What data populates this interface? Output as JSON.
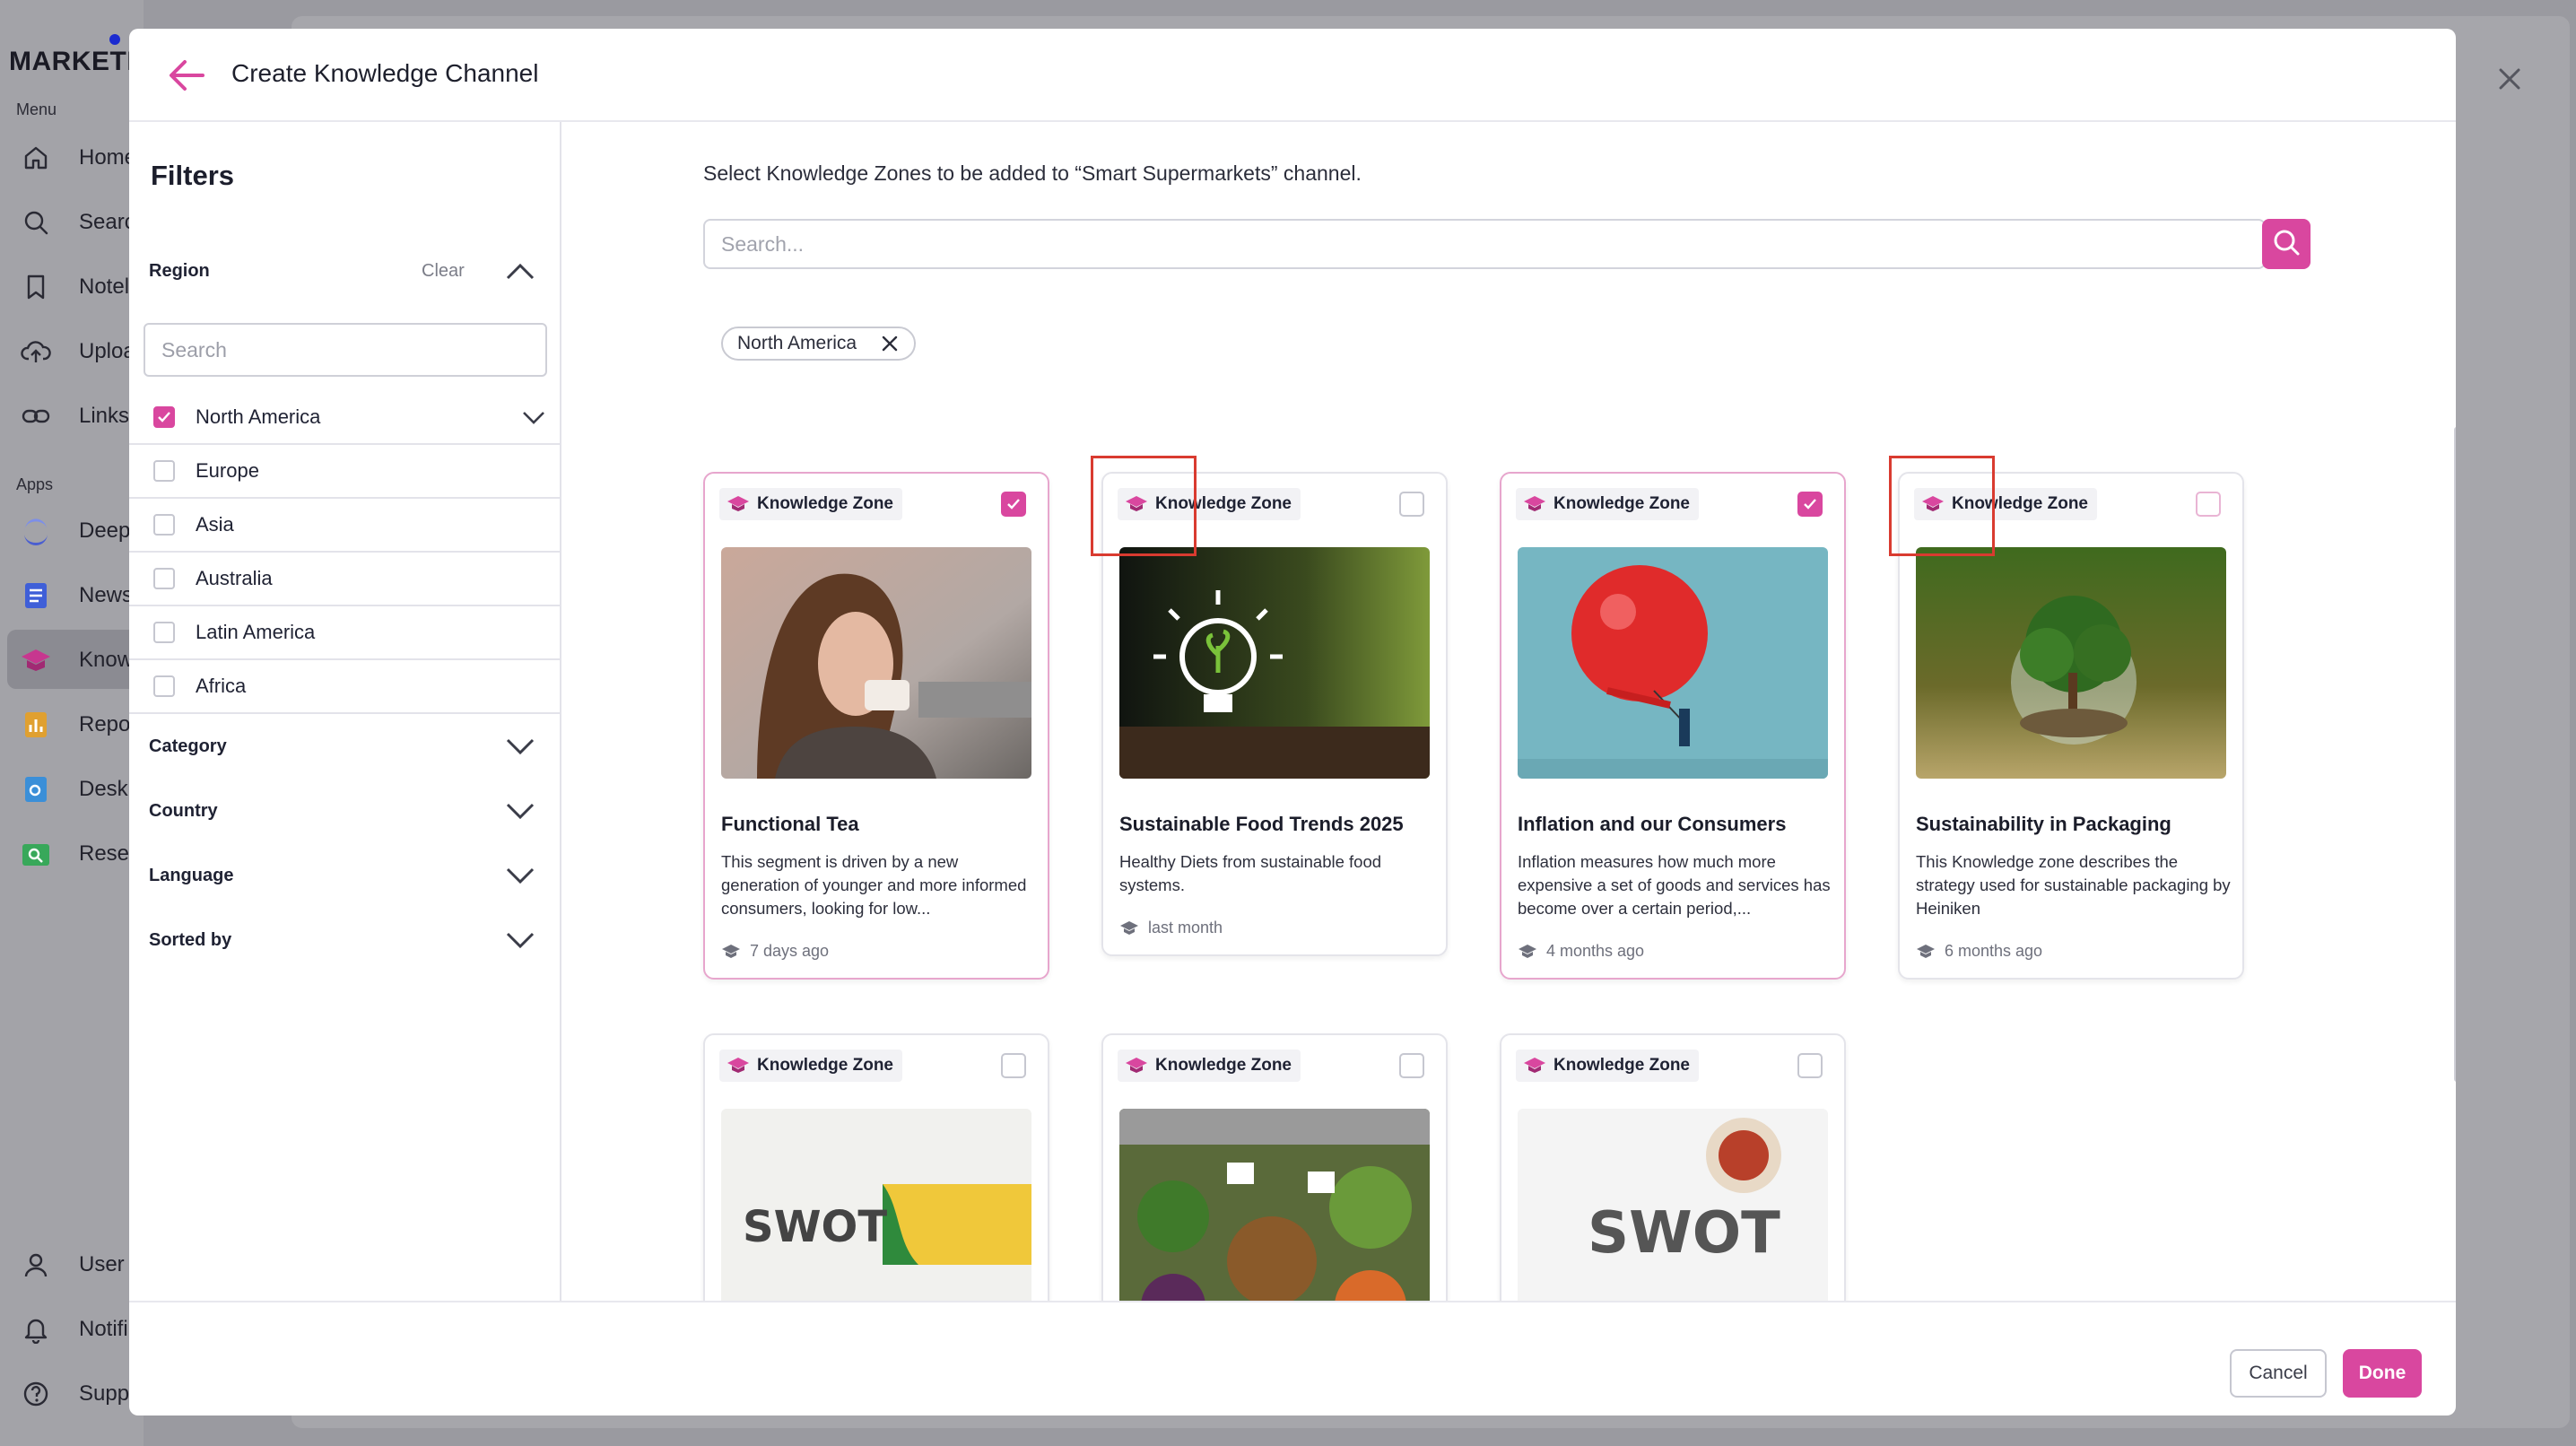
{
  "background": {
    "logo": "MARKETL",
    "menu_label": "Menu",
    "apps_label": "Apps",
    "menu_items": [
      {
        "label": "Home",
        "icon": "home-icon"
      },
      {
        "label": "Searc",
        "icon": "search-icon"
      },
      {
        "label": "Notel",
        "icon": "bookmark-icon"
      },
      {
        "label": "Uploa",
        "icon": "upload-cloud-icon"
      },
      {
        "label": "Links",
        "icon": "link-icon"
      }
    ],
    "app_items": [
      {
        "label": "Deep",
        "icon": "deep-app-icon",
        "color": "#5f6fd8"
      },
      {
        "label": "News",
        "icon": "news-app-icon",
        "color": "#3f5fd8"
      },
      {
        "label": "Know",
        "icon": "knowledge-app-icon",
        "color": "#c7378f"
      },
      {
        "label": "Repo",
        "icon": "reports-app-icon",
        "color": "#e0a030"
      },
      {
        "label": "Desk",
        "icon": "desk-app-icon",
        "color": "#3b8fd8"
      },
      {
        "label": "Resea",
        "icon": "research-app-icon",
        "color": "#38a85a"
      }
    ],
    "bottom_items": [
      {
        "label": "User",
        "icon": "user-icon"
      },
      {
        "label": "Notifi",
        "icon": "bell-icon"
      },
      {
        "label": "Supp",
        "icon": "help-icon"
      }
    ]
  },
  "modal": {
    "title": "Create Knowledge Channel",
    "filters": {
      "title": "Filters",
      "region": {
        "label": "Region",
        "clear_label": "Clear",
        "search_placeholder": "Search",
        "options": [
          {
            "label": "North America",
            "checked": true
          },
          {
            "label": "Europe",
            "checked": false
          },
          {
            "label": "Asia",
            "checked": false
          },
          {
            "label": "Australia",
            "checked": false
          },
          {
            "label": "Latin America",
            "checked": false
          },
          {
            "label": "Africa",
            "checked": false
          }
        ]
      },
      "sections": [
        "Category",
        "Country",
        "Language",
        "Sorted by"
      ]
    },
    "intro": "Select Knowledge Zones to be added to “Smart Supermarkets” channel.",
    "search_placeholder": "Search...",
    "active_chip": "North America",
    "badge_label": "Knowledge Zone",
    "cards": [
      {
        "title": "Functional Tea",
        "description": "This segment is driven by a new generation of younger and more informed consumers, looking for low...",
        "date": "7 days ago",
        "selected": true
      },
      {
        "title": "Sustainable Food Trends 2025",
        "description": "Healthy Diets from sustainable food systems.",
        "date": "last month",
        "selected": false
      },
      {
        "title": "Inflation and our Consumers",
        "description": "Inflation measures how much more expensive a set of goods and services has become over a certain period,...",
        "date": "4 months ago",
        "selected": true
      },
      {
        "title": "Sustainability in Packaging",
        "description": "This Knowledge zone describes the strategy used for sustainable packaging by Heiniken",
        "date": "6 months ago",
        "selected": false
      },
      {
        "title": "",
        "description": "",
        "date": "",
        "selected": false,
        "image_text": "SWOT"
      },
      {
        "title": "",
        "description": "",
        "date": "",
        "selected": false
      },
      {
        "title": "",
        "description": "",
        "date": "",
        "selected": false,
        "image_text": "SWOT"
      }
    ],
    "footer": {
      "cancel_label": "Cancel",
      "done_label": "Done"
    },
    "colors": {
      "accent": "#d9479f",
      "highlight": "#d93b30"
    }
  }
}
